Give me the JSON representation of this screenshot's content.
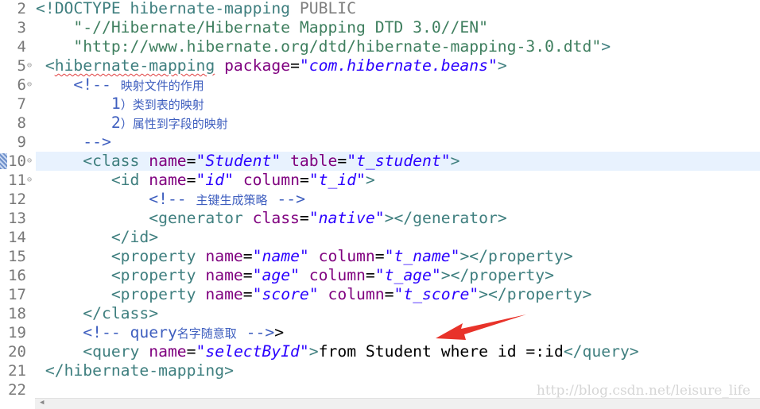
{
  "editor": {
    "current_line": 10,
    "lines": [
      {
        "n": "2",
        "indent": 0,
        "fold": false,
        "tokens": [
          [
            "tag",
            "<!DOCTYPE "
          ],
          [
            "dtk",
            "hibernate-mapping"
          ],
          [
            "dtp",
            " PUBLIC"
          ]
        ]
      },
      {
        "n": "3",
        "indent": 4,
        "fold": false,
        "tokens": [
          [
            "dstr",
            "\"-//Hibernate/Hibernate Mapping DTD 3.0//EN\""
          ]
        ]
      },
      {
        "n": "4",
        "indent": 4,
        "fold": false,
        "tokens": [
          [
            "dstr",
            "\"http://www.hibernate.org/dtd/hibernate-mapping-3.0.dtd\""
          ],
          [
            "tag",
            ">"
          ]
        ]
      },
      {
        "n": "5",
        "indent": 1,
        "fold": true,
        "tokens": [
          [
            "tag",
            "<"
          ],
          [
            "tag squig",
            "hibernate-mapping"
          ],
          [
            "txt",
            " "
          ],
          [
            "attr",
            "package"
          ],
          [
            "txt",
            "="
          ],
          [
            "str",
            "\"com.hibernate.beans\""
          ],
          [
            "tag",
            ">"
          ]
        ]
      },
      {
        "n": "6",
        "indent": 4,
        "fold": true,
        "tokens": [
          [
            "cmt",
            "<!-- "
          ],
          [
            "cjk",
            "映射文件的作用"
          ]
        ]
      },
      {
        "n": "7",
        "indent": 8,
        "fold": false,
        "tokens": [
          [
            "cmt",
            "1"
          ],
          [
            "cjk",
            "）类到表的映射"
          ]
        ]
      },
      {
        "n": "8",
        "indent": 8,
        "fold": false,
        "tokens": [
          [
            "cmt",
            "2"
          ],
          [
            "cjk",
            "）属性到字段的映射"
          ]
        ]
      },
      {
        "n": "9",
        "indent": 5,
        "fold": false,
        "tokens": [
          [
            "cmt",
            "-->"
          ]
        ]
      },
      {
        "n": "10",
        "indent": 5,
        "fold": true,
        "tokens": [
          [
            "tag",
            "<class"
          ],
          [
            "txt",
            " "
          ],
          [
            "attr",
            "name"
          ],
          [
            "txt",
            "="
          ],
          [
            "str",
            "\"Student\""
          ],
          [
            "txt",
            " "
          ],
          [
            "attr",
            "table"
          ],
          [
            "txt",
            "="
          ],
          [
            "str",
            "\"t_student\""
          ],
          [
            "tag",
            ">"
          ]
        ]
      },
      {
        "n": "11",
        "indent": 8,
        "fold": true,
        "tokens": [
          [
            "tag",
            "<id"
          ],
          [
            "txt",
            " "
          ],
          [
            "attr",
            "name"
          ],
          [
            "txt",
            "="
          ],
          [
            "str",
            "\"id\""
          ],
          [
            "txt",
            " "
          ],
          [
            "attr",
            "column"
          ],
          [
            "txt",
            "="
          ],
          [
            "str",
            "\"t_id\""
          ],
          [
            "tag",
            ">"
          ]
        ]
      },
      {
        "n": "12",
        "indent": 12,
        "fold": false,
        "tokens": [
          [
            "cmt",
            "<!-- "
          ],
          [
            "cjk",
            "主键生成策略"
          ],
          [
            "cmt",
            " -->"
          ]
        ]
      },
      {
        "n": "13",
        "indent": 12,
        "fold": false,
        "tokens": [
          [
            "tag",
            "<generator"
          ],
          [
            "txt",
            " "
          ],
          [
            "attr",
            "class"
          ],
          [
            "txt",
            "="
          ],
          [
            "str",
            "\"native\""
          ],
          [
            "tag",
            "></generator>"
          ]
        ]
      },
      {
        "n": "14",
        "indent": 8,
        "fold": false,
        "tokens": [
          [
            "tag",
            "</id>"
          ]
        ]
      },
      {
        "n": "15",
        "indent": 8,
        "fold": false,
        "tokens": [
          [
            "tag",
            "<property"
          ],
          [
            "txt",
            " "
          ],
          [
            "attr",
            "name"
          ],
          [
            "txt",
            "="
          ],
          [
            "str",
            "\"name\""
          ],
          [
            "txt",
            " "
          ],
          [
            "attr",
            "column"
          ],
          [
            "txt",
            "="
          ],
          [
            "str",
            "\"t_name\""
          ],
          [
            "tag",
            "></property>"
          ]
        ]
      },
      {
        "n": "16",
        "indent": 8,
        "fold": false,
        "tokens": [
          [
            "tag",
            "<property"
          ],
          [
            "txt",
            " "
          ],
          [
            "attr",
            "name"
          ],
          [
            "txt",
            "="
          ],
          [
            "str",
            "\"age\""
          ],
          [
            "txt",
            " "
          ],
          [
            "attr",
            "column"
          ],
          [
            "txt",
            "="
          ],
          [
            "str",
            "\"t_age\""
          ],
          [
            "tag",
            "></property>"
          ]
        ]
      },
      {
        "n": "17",
        "indent": 8,
        "fold": false,
        "tokens": [
          [
            "tag",
            "<property"
          ],
          [
            "txt",
            " "
          ],
          [
            "attr",
            "name"
          ],
          [
            "txt",
            "="
          ],
          [
            "str",
            "\"score\""
          ],
          [
            "txt",
            " "
          ],
          [
            "attr",
            "column"
          ],
          [
            "txt",
            "="
          ],
          [
            "str",
            "\"t_score\""
          ],
          [
            "tag",
            "></property>"
          ]
        ]
      },
      {
        "n": "18",
        "indent": 5,
        "fold": false,
        "tokens": [
          [
            "tag",
            "</class>"
          ]
        ]
      },
      {
        "n": "19",
        "indent": 5,
        "fold": false,
        "tokens": [
          [
            "cmt",
            "<!-- query"
          ],
          [
            "cjk",
            "名字随意取"
          ],
          [
            "cmt",
            " -->"
          ],
          [
            "txt",
            ">"
          ]
        ]
      },
      {
        "n": "20",
        "indent": 5,
        "fold": false,
        "tokens": [
          [
            "tag",
            "<query"
          ],
          [
            "txt",
            " "
          ],
          [
            "attr",
            "name"
          ],
          [
            "txt",
            "="
          ],
          [
            "str",
            "\"selectById\""
          ],
          [
            "tag",
            ">"
          ],
          [
            "txt",
            "from Student where id =:id"
          ],
          [
            "tag",
            "</query>"
          ]
        ]
      },
      {
        "n": "21",
        "indent": 1,
        "fold": false,
        "tokens": [
          [
            "tag",
            "</hibernate-mapping>"
          ]
        ]
      },
      {
        "n": "22",
        "indent": 0,
        "fold": false,
        "tokens": []
      }
    ]
  },
  "watermark": "http://blog.csdn.net/leisure_life",
  "colors": {
    "tag": "#3f7f7f",
    "attribute": "#7f007f",
    "string": "#2a00ff",
    "comment": "#3f5fbf",
    "current_line": "#e8f2fe",
    "annotation_arrow": "#e8332a"
  },
  "icons": {
    "fold": "fold-collapse-icon",
    "scroll_left": "scroll-left-arrow-icon"
  }
}
